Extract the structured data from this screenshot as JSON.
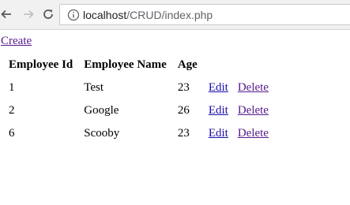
{
  "browser": {
    "url_host": "localhost",
    "url_path": "/CRUD/index.php"
  },
  "page": {
    "create_label": "Create",
    "headers": [
      "Employee Id",
      "Employee Name",
      "Age"
    ],
    "rows": [
      {
        "id": "1",
        "name": "Test",
        "age": "23",
        "edit": "Edit",
        "delete": "Delete"
      },
      {
        "id": "2",
        "name": "Google",
        "age": "26",
        "edit": "Edit",
        "delete": "Delete"
      },
      {
        "id": "6",
        "name": "Scooby",
        "age": "23",
        "edit": "Edit",
        "delete": "Delete"
      }
    ]
  },
  "icons": {
    "back": "back-arrow-icon",
    "forward": "forward-arrow-icon",
    "reload": "reload-icon",
    "info": "info-icon"
  }
}
